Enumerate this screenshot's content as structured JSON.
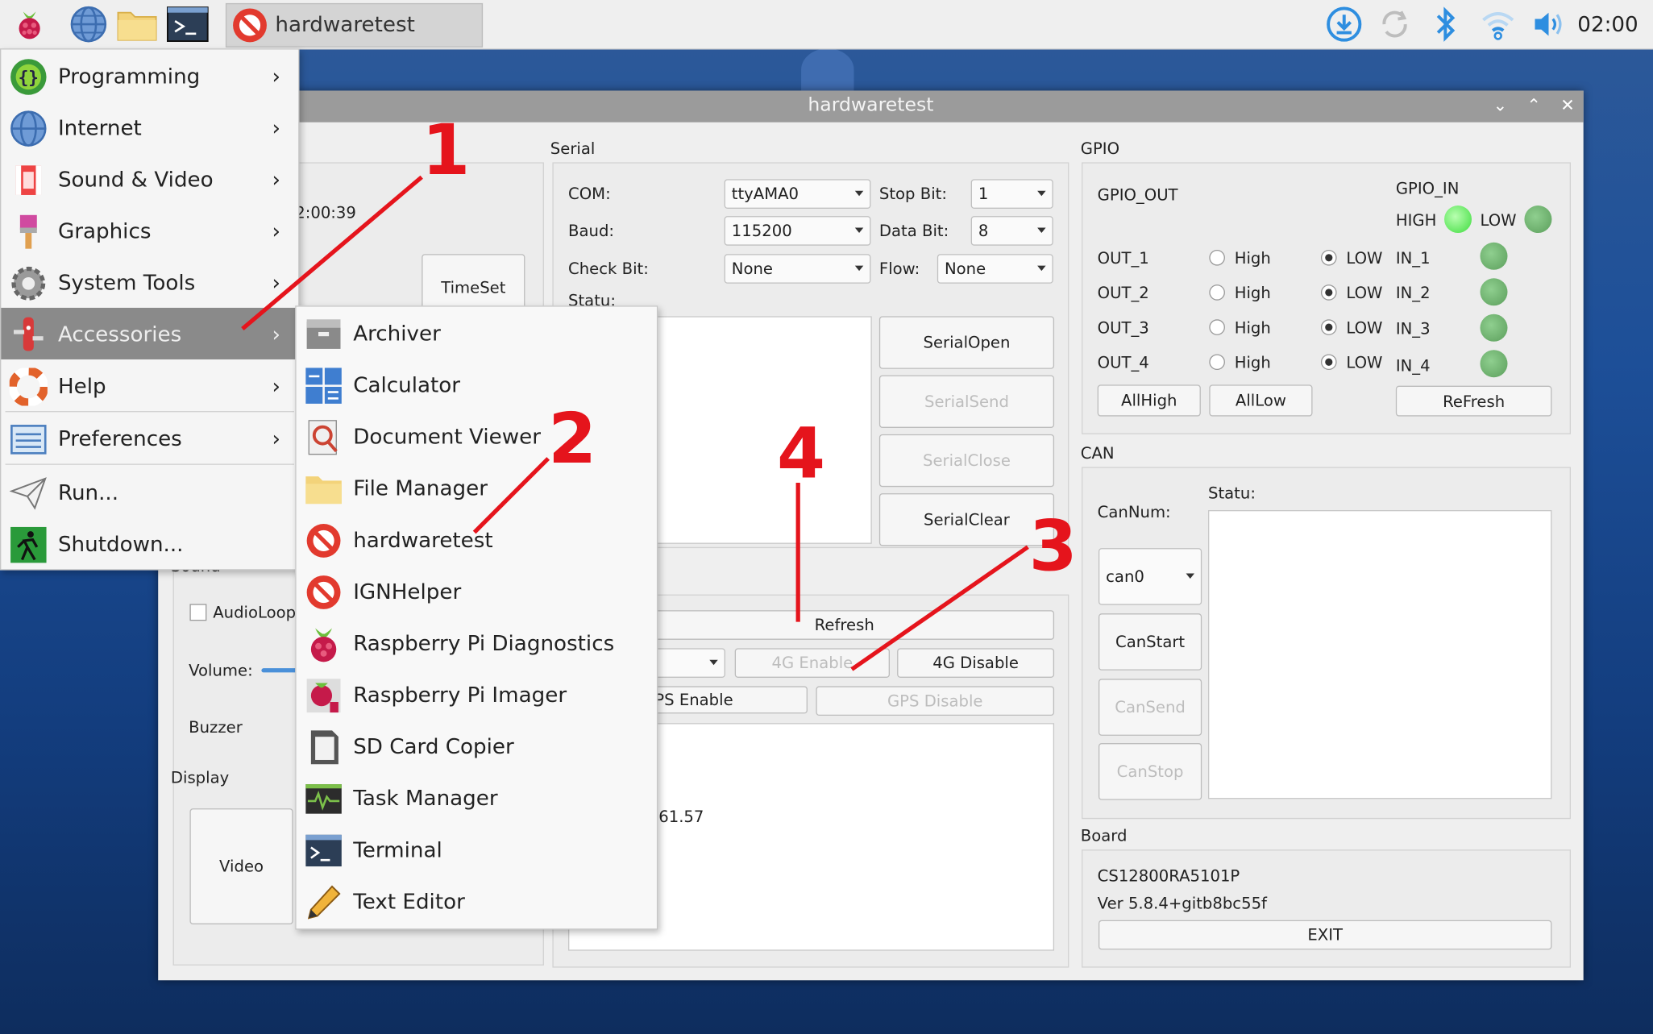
{
  "panel": {
    "task_label": "hardwaretest",
    "clock": "02:00"
  },
  "window": {
    "title": "hardwaretest",
    "left_time_partial": "2:00:39",
    "timeset_label": "TimeSet",
    "sound_title_partial": "Sound",
    "audioloop_label": "AudioLoop",
    "volume_label": "Volume:",
    "buzzer_label": "Buzzer",
    "display_title": "Display",
    "video_label": "Video",
    "serial": {
      "title": "Serial",
      "com_label": "COM:",
      "com_value": "ttyAMA0",
      "stopbit_label": "Stop Bit:",
      "stopbit_value": "1",
      "baud_label": "Baud:",
      "baud_value": "115200",
      "databit_label": "Data Bit:",
      "databit_value": "8",
      "checkbit_label": "Check Bit:",
      "checkbit_value": "None",
      "flow_label": "Flow:",
      "flow_value": "None",
      "statu_label": "Statu:",
      "open": "SerialOpen",
      "send": "SerialSend",
      "close": "SerialClose",
      "clear": "SerialClear"
    },
    "net": {
      "refresh": "Refresh",
      "enable4g": "4G Enable",
      "disable4g": "4G Disable",
      "gps_enable_partial": "PS Enable",
      "gps_disable": "GPS Disable",
      "ip_partial": ".61.57"
    },
    "gpio": {
      "title": "GPIO",
      "out_title": "GPIO_OUT",
      "in_title": "GPIO_IN",
      "high_label": "HIGH",
      "low_label": "LOW",
      "rows": [
        {
          "out": "OUT_1",
          "high": "High",
          "low": "LOW",
          "in": "IN_1"
        },
        {
          "out": "OUT_2",
          "high": "High",
          "low": "LOW",
          "in": "IN_2"
        },
        {
          "out": "OUT_3",
          "high": "High",
          "low": "LOW",
          "in": "IN_3"
        },
        {
          "out": "OUT_4",
          "high": "High",
          "low": "LOW",
          "in": "IN_4"
        }
      ],
      "allhigh": "AllHigh",
      "alllow": "AllLow",
      "refresh": "ReFresh"
    },
    "can": {
      "title": "CAN",
      "statu_label": "Statu:",
      "cannum_label": "CanNum:",
      "cannum_value": "can0",
      "start": "CanStart",
      "send": "CanSend",
      "stop": "CanStop"
    },
    "board": {
      "title": "Board",
      "model": "CS12800RA5101P",
      "version": "Ver 5.8.4+gitb8bc55f",
      "exit": "EXIT"
    }
  },
  "menu": {
    "items": [
      {
        "label": "Programming",
        "icon": "programming-icon"
      },
      {
        "label": "Internet",
        "icon": "globe-icon"
      },
      {
        "label": "Sound & Video",
        "icon": "film-icon"
      },
      {
        "label": "Graphics",
        "icon": "paintbrush-icon"
      },
      {
        "label": "System Tools",
        "icon": "gear-icon"
      },
      {
        "label": "Accessories",
        "icon": "knife-icon"
      },
      {
        "label": "Help",
        "icon": "lifebuoy-icon"
      },
      {
        "label": "Preferences",
        "icon": "preferences-icon"
      },
      {
        "label": "Run...",
        "icon": "paper-plane-icon"
      },
      {
        "label": "Shutdown...",
        "icon": "exit-icon"
      }
    ]
  },
  "submenu": {
    "items": [
      {
        "label": "Archiver"
      },
      {
        "label": "Calculator"
      },
      {
        "label": "Document Viewer"
      },
      {
        "label": "File Manager"
      },
      {
        "label": "hardwaretest"
      },
      {
        "label": "IGNHelper"
      },
      {
        "label": "Raspberry Pi Diagnostics"
      },
      {
        "label": "Raspberry Pi Imager"
      },
      {
        "label": "SD Card Copier"
      },
      {
        "label": "Task Manager"
      },
      {
        "label": "Terminal"
      },
      {
        "label": "Text Editor"
      }
    ]
  },
  "annotations": {
    "n1": "1",
    "n2": "2",
    "n3": "3",
    "n4": "4"
  },
  "colors": {
    "annotation": "#e5141c",
    "menu_selected": "#8a8a8a",
    "desktop": "#1d4f98"
  }
}
